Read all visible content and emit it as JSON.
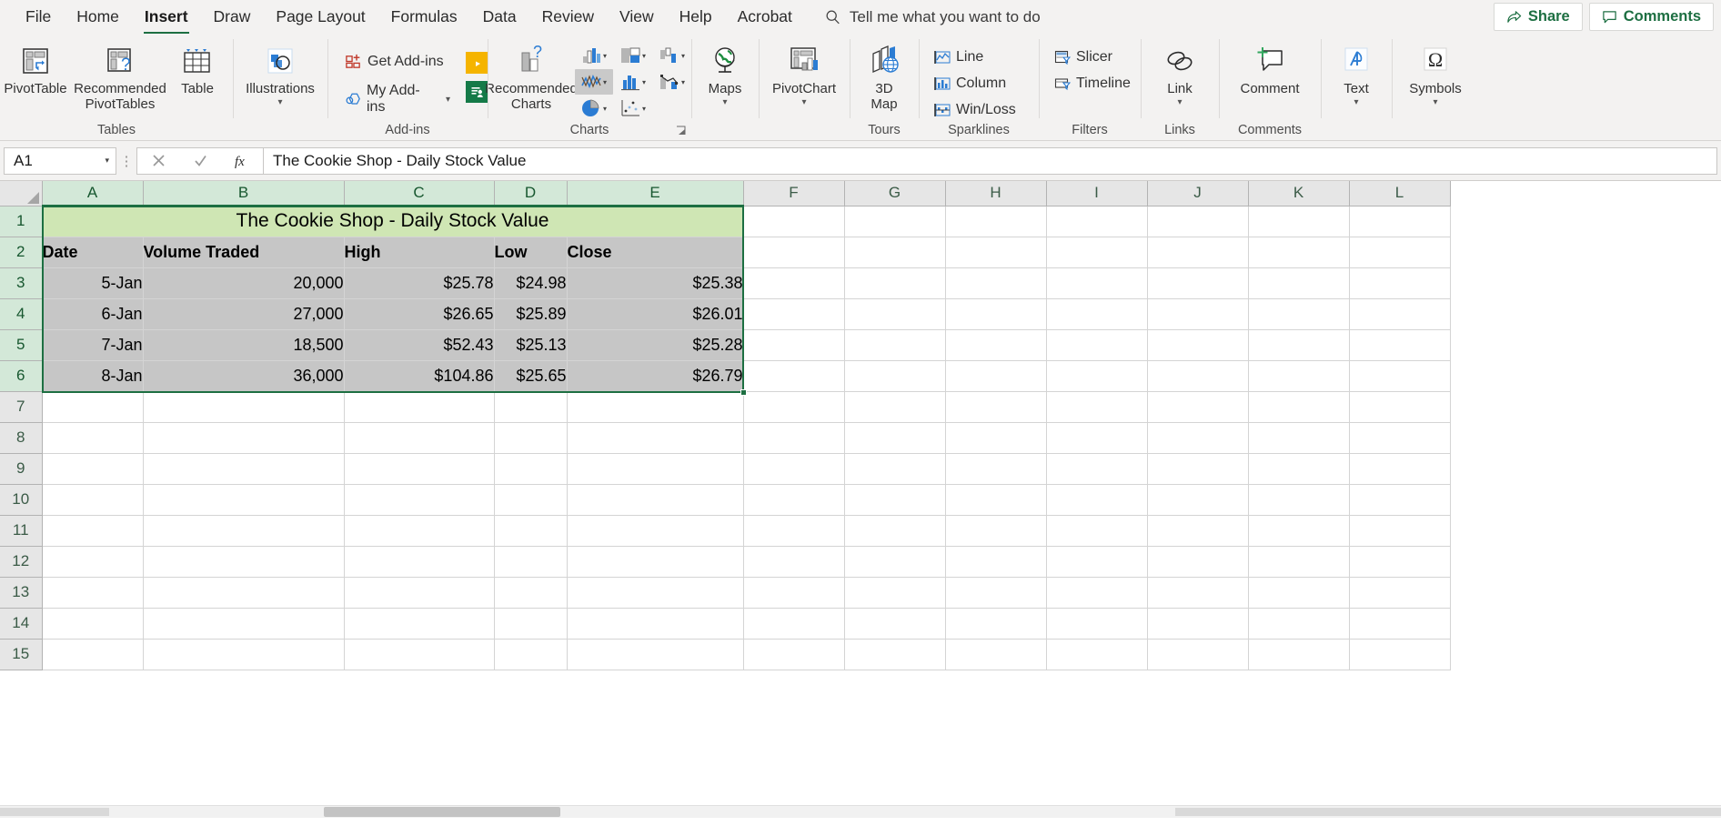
{
  "ribbon": {
    "tabs": [
      {
        "label": "File",
        "active": false
      },
      {
        "label": "Home",
        "active": false
      },
      {
        "label": "Insert",
        "active": true
      },
      {
        "label": "Draw",
        "active": false
      },
      {
        "label": "Page Layout",
        "active": false
      },
      {
        "label": "Formulas",
        "active": false
      },
      {
        "label": "Data",
        "active": false
      },
      {
        "label": "Review",
        "active": false
      },
      {
        "label": "View",
        "active": false
      },
      {
        "label": "Help",
        "active": false
      },
      {
        "label": "Acrobat",
        "active": false
      }
    ],
    "tell_me": "Tell me what you want to do",
    "share": "Share",
    "comments": "Comments",
    "groups": {
      "tables": {
        "label": "Tables",
        "pivottable": "PivotTable",
        "recommended_pivottables": "Recommended\nPivotTables",
        "table": "Table"
      },
      "illustrations": {
        "label": "",
        "illustrations": "Illustrations"
      },
      "addins": {
        "label": "Add-ins",
        "get_addins": "Get Add-ins",
        "my_addins": "My Add-ins"
      },
      "charts": {
        "label": "Charts",
        "recommended_charts": "Recommended\nCharts",
        "items": [
          {
            "name": "column-bar-chart",
            "selected": false
          },
          {
            "name": "hierarchy-chart",
            "selected": false
          },
          {
            "name": "waterfall-chart",
            "selected": false
          },
          {
            "name": "stock-surface-radar-chart",
            "selected": true
          },
          {
            "name": "statistic-chart",
            "selected": false
          },
          {
            "name": "combo-chart",
            "selected": false
          },
          {
            "name": "pie-doughnut-chart",
            "selected": false
          },
          {
            "name": "scatter-chart",
            "selected": false
          }
        ]
      },
      "maps": {
        "label": "",
        "maps": "Maps"
      },
      "pivotchart": {
        "label": "",
        "pivotchart": "PivotChart"
      },
      "tours": {
        "label": "Tours",
        "three_d_map": "3D\nMap"
      },
      "sparklines": {
        "label": "Sparklines",
        "line": "Line",
        "column": "Column",
        "winloss": "Win/Loss"
      },
      "filters": {
        "label": "Filters",
        "slicer": "Slicer",
        "timeline": "Timeline"
      },
      "links": {
        "label": "Links",
        "link": "Link"
      },
      "comments_group": {
        "label": "Comments",
        "comment": "Comment"
      },
      "text": {
        "label": "",
        "text": "Text"
      },
      "symbols": {
        "label": "",
        "symbols": "Symbols"
      }
    }
  },
  "formula_bar": {
    "name_box": "A1",
    "cancel_icon": "cancel-icon",
    "enter_icon": "confirm-icon",
    "fx_icon": "insert-function-icon",
    "content": "The Cookie Shop - Daily Stock Value"
  },
  "sheet": {
    "column_headers": [
      "A",
      "B",
      "C",
      "D",
      "E",
      "F",
      "G",
      "H",
      "I",
      "J",
      "K",
      "L"
    ],
    "row_numbers": [
      "1",
      "2",
      "3",
      "4",
      "5",
      "6",
      "7",
      "8",
      "9",
      "10",
      "11",
      "12",
      "13",
      "14",
      "15"
    ],
    "title_cell": "The Cookie Shop - Daily Stock Value",
    "header_row": [
      "Date",
      "Volume Traded",
      "High",
      "Low",
      "Close"
    ],
    "rows": [
      {
        "date": "5-Jan",
        "volume": "20,000",
        "high": "$25.78",
        "low": "$24.98",
        "close": "$25.38"
      },
      {
        "date": "6-Jan",
        "volume": "27,000",
        "high": "$26.65",
        "low": "$25.89",
        "close": "$26.01"
      },
      {
        "date": "7-Jan",
        "volume": "18,500",
        "high": "$52.43",
        "low": "$25.13",
        "close": "$25.28"
      },
      {
        "date": "8-Jan",
        "volume": "36,000",
        "high": "$104.86",
        "low": "$25.65",
        "close": "$26.79"
      }
    ]
  },
  "colors": {
    "excel_green": "#1d6f42",
    "title_fill": "#cfe6b4",
    "selection_fill": "#c6c6c6",
    "ribbon_bg": "#f3f2f1"
  }
}
